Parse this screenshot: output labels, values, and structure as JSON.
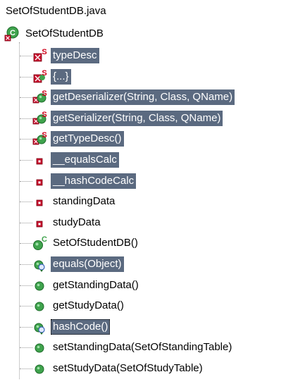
{
  "file": {
    "name": "SetOfStudentDB.java"
  },
  "class_node": {
    "name": "SetOfStudentDB"
  },
  "members": [
    {
      "label": "typeDesc",
      "icon": "private-static-field-icon",
      "selected": true
    },
    {
      "label": "{...}",
      "icon": "private-static-initializer-icon",
      "selected": true
    },
    {
      "label": "getDeserializer(String, Class, QName)",
      "icon": "public-static-method-icon",
      "selected": true
    },
    {
      "label": "getSerializer(String, Class, QName)",
      "icon": "public-static-method-icon",
      "selected": true
    },
    {
      "label": "getTypeDesc()",
      "icon": "public-static-method-icon",
      "selected": true
    },
    {
      "label": "__equalsCalc",
      "icon": "private-field-icon",
      "selected": true
    },
    {
      "label": "__hashCodeCalc",
      "icon": "private-field-icon",
      "selected": true
    },
    {
      "label": "standingData",
      "icon": "private-field-icon",
      "selected": false
    },
    {
      "label": "studyData",
      "icon": "private-field-icon",
      "selected": false
    },
    {
      "label": "SetOfStudentDB()",
      "icon": "constructor-icon",
      "selected": false
    },
    {
      "label": "equals(Object)",
      "icon": "override-method-icon",
      "selected": true
    },
    {
      "label": "getStandingData()",
      "icon": "public-method-icon",
      "selected": false
    },
    {
      "label": "getStudyData()",
      "icon": "public-method-icon",
      "selected": false
    },
    {
      "label": "hashCode()",
      "icon": "override-method-icon",
      "selected": true
    },
    {
      "label": "setStandingData(SetOfStandingTable)",
      "icon": "public-method-icon",
      "selected": false
    },
    {
      "label": "setStudyData(SetOfStudyTable)",
      "icon": "public-method-icon",
      "selected": false
    }
  ],
  "colors": {
    "selection": "#5b6a80",
    "public_green": "#3fa34d",
    "private_red": "#c8102e",
    "static_red": "#d0021b",
    "override_blue": "#3a63b8"
  }
}
